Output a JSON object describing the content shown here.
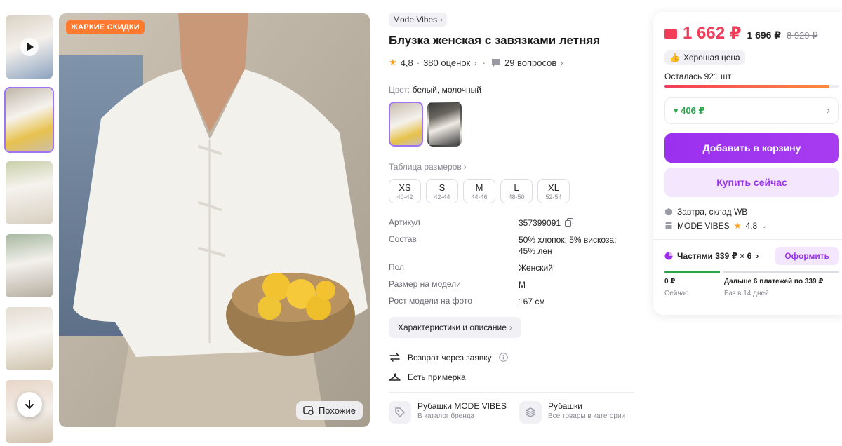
{
  "gallery": {
    "hot_badge": "ЖАРКИЕ СКИДКИ",
    "similar_label": "Похожие"
  },
  "product": {
    "brand": "Mode Vibes",
    "title": "Блузка женская с завязками летняя",
    "rating": "4,8",
    "reviews": "380 оценок",
    "questions": "29 вопросов",
    "color_label": "Цвет:",
    "color_value": "белый, молочный",
    "size_table_link": "Таблица размеров",
    "sizes": [
      {
        "size": "XS",
        "range": "40-42"
      },
      {
        "size": "S",
        "range": "42-44"
      },
      {
        "size": "M",
        "range": "44-46"
      },
      {
        "size": "L",
        "range": "48-50"
      },
      {
        "size": "XL",
        "range": "52-54"
      }
    ],
    "specs": [
      {
        "key": "Артикул",
        "value": "357399091"
      },
      {
        "key": "Состав",
        "value": "50% хлопок; 5% вискоза; 45% лен"
      },
      {
        "key": "Пол",
        "value": "Женский"
      },
      {
        "key": "Размер на модели",
        "value": "M"
      },
      {
        "key": "Рост модели на фото",
        "value": "167 см"
      }
    ],
    "characteristics_btn": "Характеристики и описание",
    "return_label": "Возврат через заявку",
    "fitting_label": "Есть примерка",
    "categories": [
      {
        "title": "Рубашки MODE VIBES",
        "sub": "В каталог бренда"
      },
      {
        "title": "Рубашки",
        "sub": "Все товары в категории"
      }
    ]
  },
  "buy_panel": {
    "price": "1 662 ₽",
    "price_no_wallet": "1 696 ₽",
    "price_old": "8 929 ₽",
    "good_price": "Хорошая цена",
    "left": "Осталась 921 шт",
    "left_fraction": 0.94,
    "discount": "▾ 406 ₽",
    "add_to_cart": "Добавить в корзину",
    "buy_now": "Купить сейчас",
    "delivery": "Завтра, склад WB",
    "seller": "MODE VIBES",
    "seller_rating": "4,8",
    "installments": "Частями 339 ₽ × 6",
    "installments_btn": "Оформить",
    "pay_now_amount": "0 ₽",
    "pay_now_label": "Сейчас",
    "pay_later_amount": "Дальше 6 платежей по 339 ₽",
    "pay_later_label": "Раз в 14 дней"
  },
  "colors": {
    "accent": "#9b30ef",
    "price_red": "#f13c5a",
    "hot_orange": "#ff7a2e",
    "green": "#2ba54a"
  }
}
